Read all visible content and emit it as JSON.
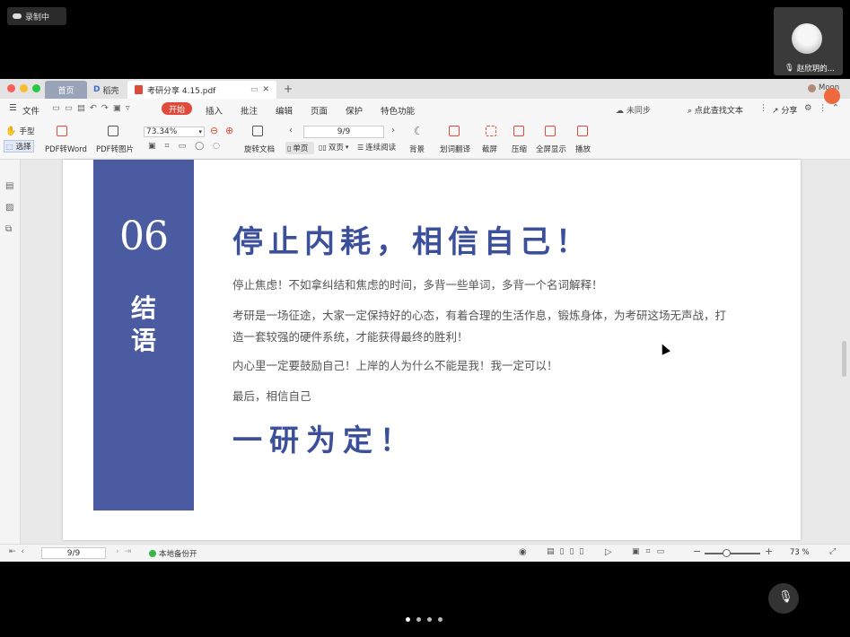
{
  "recording": {
    "label": "录制中"
  },
  "participant": {
    "name": "赵欣玥的..."
  },
  "window": {
    "tabs": [
      {
        "label": "首页"
      },
      {
        "label": "稻壳"
      },
      {
        "label": "考研分享 4.15.pdf"
      }
    ],
    "user": "Moon"
  },
  "menubar": {
    "file": "文件",
    "start": "开始",
    "items": [
      "插入",
      "批注",
      "编辑",
      "页面",
      "保护",
      "特色功能"
    ],
    "sync": "未同步",
    "search": "点此查找文本",
    "share": "分享"
  },
  "toolbar": {
    "hand": "手型",
    "select": "选择",
    "pdf_to_word": "PDF转Word",
    "pdf_to_image": "PDF转图片",
    "zoom": "73.34%",
    "page": "9/9",
    "rotate": "旋转文档",
    "single": "单页",
    "double": "双页",
    "continuous": "连续阅读",
    "background": "背景",
    "translate": "划词翻译",
    "screenshot": "截屏",
    "compress": "压缩",
    "fullscreen": "全屏显示",
    "play": "播放"
  },
  "document": {
    "section_number": "06",
    "section_title": "结\n语",
    "heading": "停止内耗，相信自己！",
    "paragraphs": [
      "停止焦虑！不如拿纠结和焦虑的时间，多背一些单词，多背一个名词解释！",
      "考研是一场征途，大家一定保持好的心态，有着合理的生活作息，锻炼身体，为考研这场无声战，打造一套较强的硬件系统，才能获得最终的胜利！",
      "内心里一定要鼓励自己！上岸的人为什么不能是我！我一定可以！",
      "最后，相信自己"
    ],
    "closing": "一研为定！"
  },
  "statusbar": {
    "page": "9/9",
    "backup": "本地备份开",
    "zoom": "73 %"
  },
  "colors": {
    "accent_blue": "#4b5ba1",
    "heading_blue": "#3c4f9a",
    "start_red": "#e04a3c"
  }
}
